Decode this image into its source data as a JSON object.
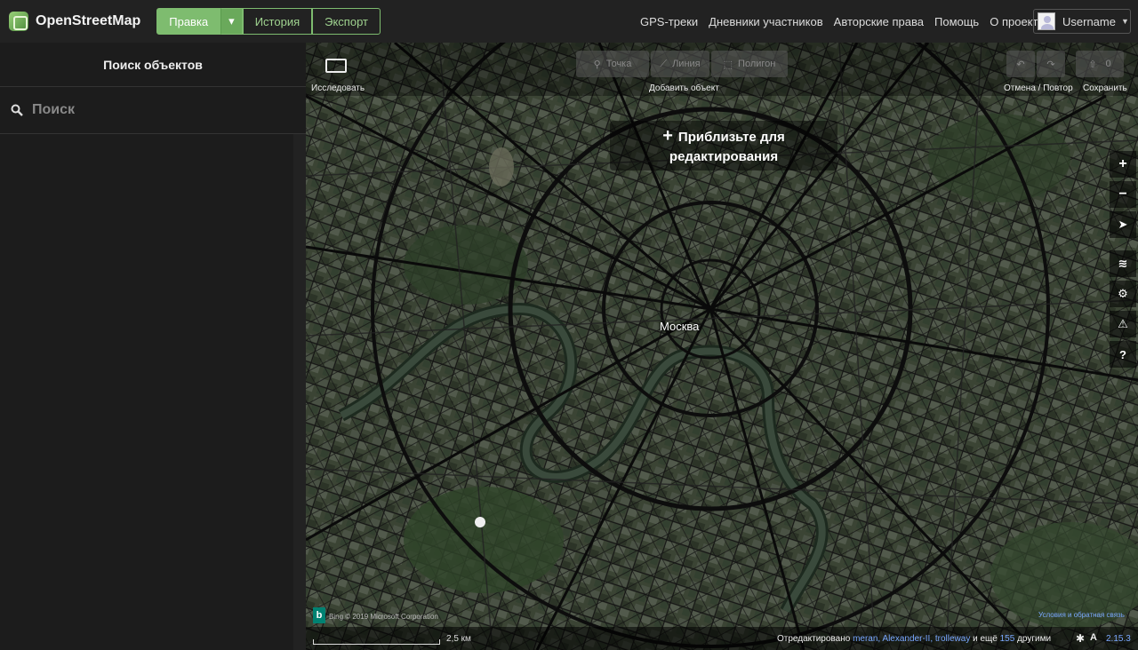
{
  "header": {
    "logo_text": "OpenStreetMap",
    "edit_label": "Правка",
    "history_label": "История",
    "export_label": "Экспорт",
    "nav": [
      "GPS-треки",
      "Дневники участников",
      "Авторские права",
      "Помощь",
      "О проекте"
    ],
    "username": "Username"
  },
  "sidebar": {
    "title": "Поиск объектов",
    "search_placeholder": "Поиск"
  },
  "map": {
    "toolbar": {
      "explore_label": "Исследовать",
      "point_label": "Точка",
      "line_label": "Линия",
      "area_label": "Полигон",
      "add_label": "Добавить объект",
      "undo_redo_label": "Отмена / Повтор",
      "save_label": "Сохранить",
      "save_count": "0"
    },
    "zoom_message": "Приблизьте для редактирования",
    "city_label": "Москва",
    "attribution": "Bing © 2019 Microsoft Corporation",
    "terms_label": "Условия и обратная связь",
    "scale_label": "2,5 км",
    "history_prefix": "Отредактировано",
    "history_users": "meran, Alexander-II, trolleway",
    "history_more_prefix": "и ещё",
    "history_more_count": "155",
    "history_more_suffix": "другими",
    "version": "2.15.3",
    "accent_color": "#7ebc6f"
  }
}
